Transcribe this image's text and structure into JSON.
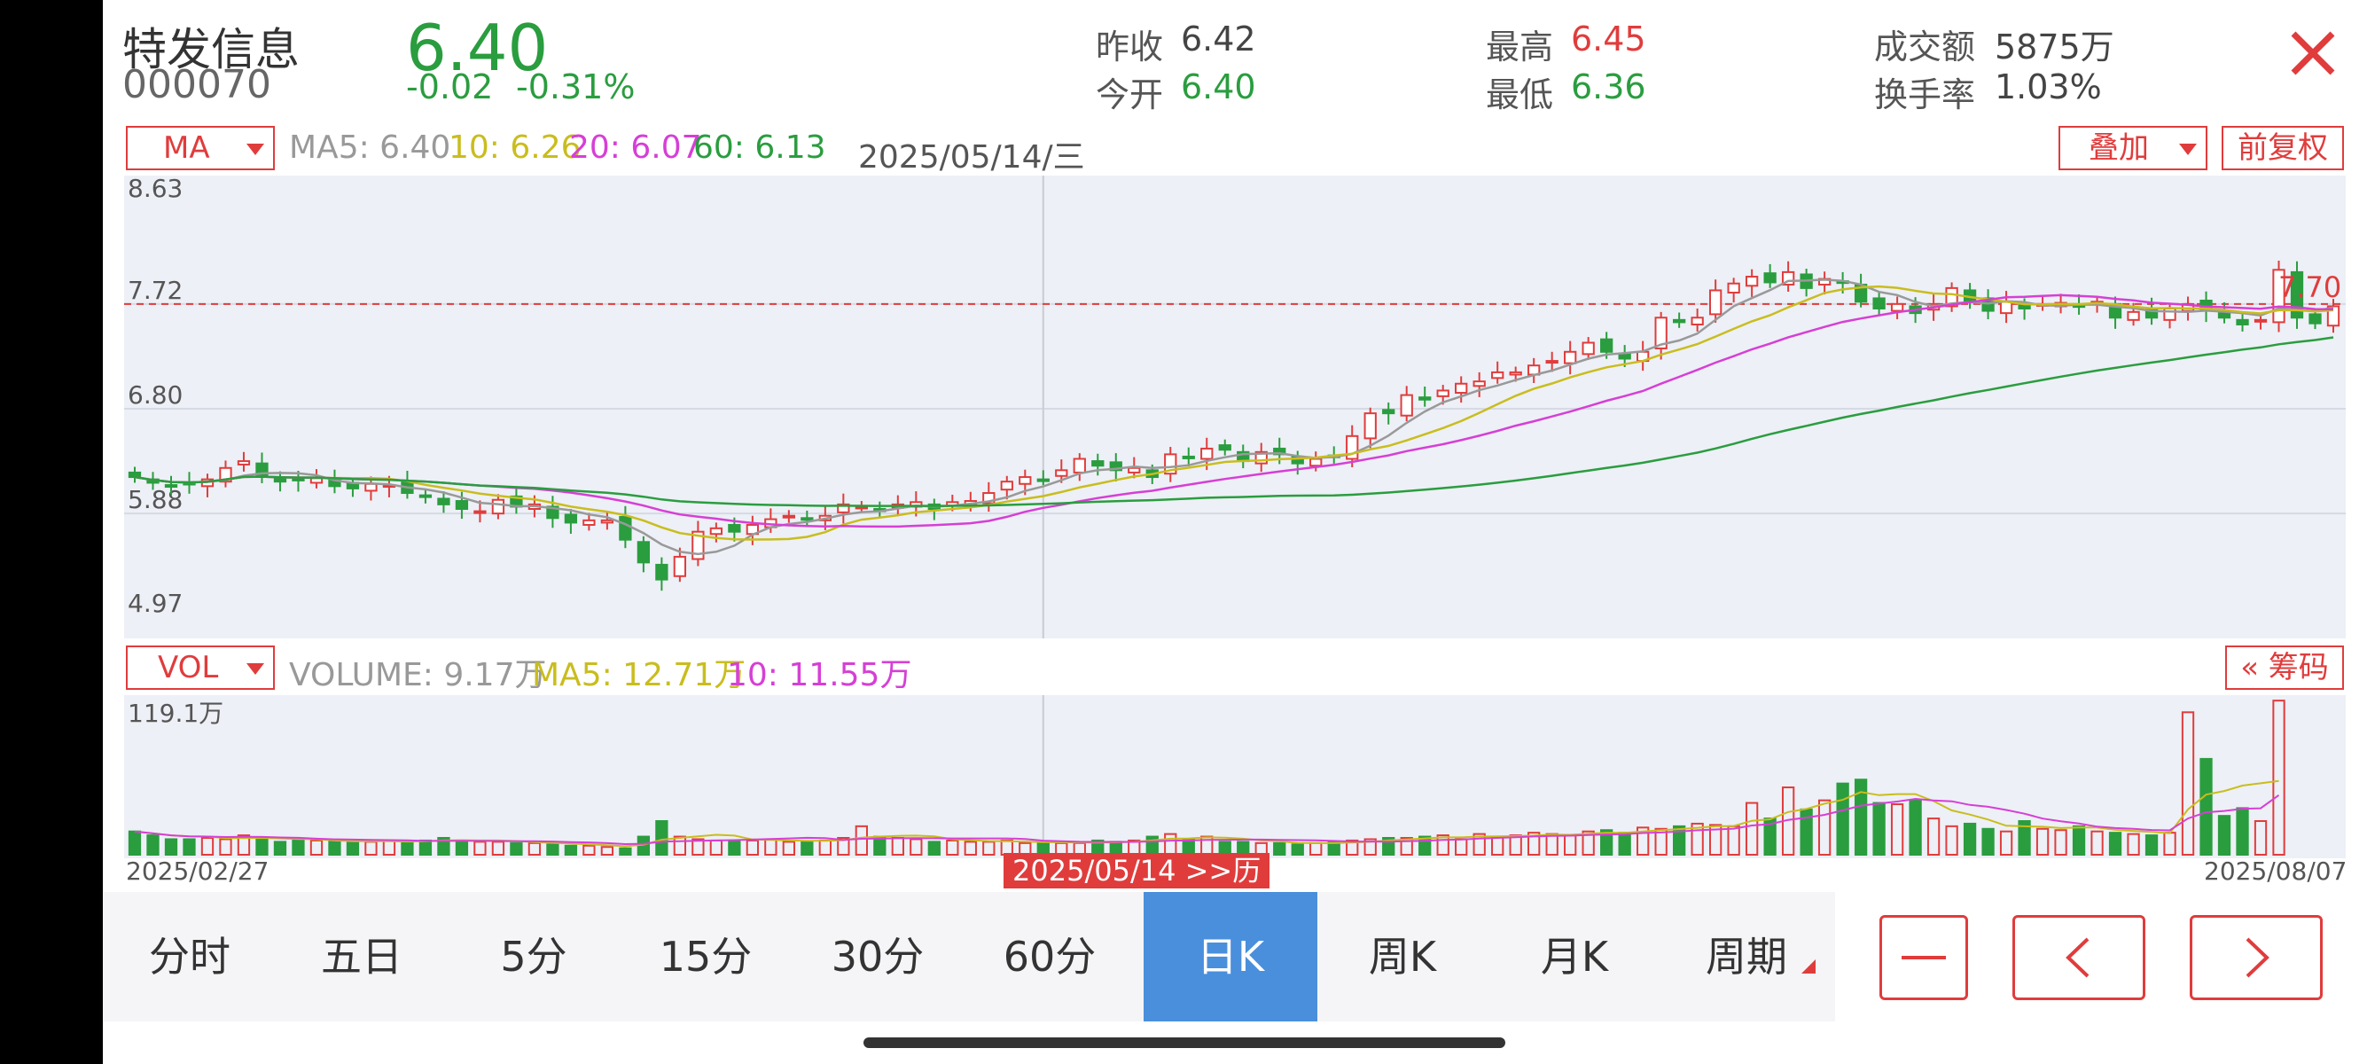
{
  "stock": {
    "name": "特发信息",
    "code": "000070",
    "price": "6.40",
    "change": "-0.02",
    "change_pct": "-0.31%"
  },
  "quote": {
    "prev_close_label": "昨收",
    "prev_close": "6.42",
    "open_label": "今开",
    "open": "6.40",
    "high_label": "最高",
    "high": "6.45",
    "low_label": "最低",
    "low": "6.36",
    "turnover_label": "成交额",
    "turnover": "5875万",
    "turnover_rate_label": "换手率",
    "turnover_rate": "1.03%"
  },
  "colors": {
    "up": "#e03c3c",
    "down": "#2a9d3f",
    "accent": "#4a8fdc",
    "ma5": "#999999",
    "ma10": "#c9bd1e",
    "ma20": "#d63fd6",
    "ma60": "#2a9d3f"
  },
  "indicator_select": "MA",
  "ma_legend": {
    "ma5": "MA5: 6.40",
    "ma10": "10: 6.26",
    "ma20": "20: 6.07",
    "ma60": "60: 6.13"
  },
  "cursor_date": "2025/05/14/三",
  "overlay_select": "叠加",
  "adjust_button": "前复权",
  "vol_select": "VOL",
  "vol_legend": {
    "volume": "VOLUME: 9.17万",
    "ma5": "MA5: 12.71万",
    "ma10": "10: 11.55万"
  },
  "chips_button": "« 筹码",
  "chart_data": {
    "type": "candlestick",
    "y_axis_labels": [
      "8.63",
      "7.72",
      "6.80",
      "5.88",
      "4.97"
    ],
    "ylim": [
      4.97,
      8.63
    ],
    "reference_line": 7.72,
    "last_label": "7.70",
    "vol_max_label": "119.1万",
    "vol_max": 119.1,
    "start_date": "2025/02/27",
    "end_date": "2025/08/07",
    "cursor_tag": "2025/05/14 >>历",
    "closes": [
      6.2,
      6.15,
      6.12,
      6.14,
      6.18,
      6.28,
      6.34,
      6.22,
      6.16,
      6.17,
      6.19,
      6.12,
      6.1,
      6.14,
      6.13,
      6.06,
      6.03,
      5.96,
      5.92,
      5.9,
      6.0,
      5.94,
      5.96,
      5.84,
      5.8,
      5.82,
      5.82,
      5.65,
      5.45,
      5.3,
      5.5,
      5.72,
      5.75,
      5.72,
      5.78,
      5.83,
      5.86,
      5.84,
      5.86,
      5.96,
      5.94,
      5.9,
      5.96,
      5.98,
      5.92,
      5.98,
      5.99,
      6.06,
      6.16,
      6.2,
      6.18,
      6.26,
      6.36,
      6.3,
      6.26,
      6.28,
      6.2,
      6.4,
      6.38,
      6.45,
      6.44,
      6.34,
      6.42,
      6.4,
      6.32,
      6.36,
      6.38,
      6.56,
      6.76,
      6.76,
      6.92,
      6.88,
      6.96,
      7.02,
      7.04,
      7.12,
      7.12,
      7.18,
      7.22,
      7.3,
      7.38,
      7.3,
      7.24,
      7.3,
      7.6,
      7.56,
      7.6,
      7.84,
      7.9,
      7.96,
      7.91,
      8.0,
      7.86,
      7.94,
      7.91,
      7.74,
      7.68,
      7.72,
      7.64,
      7.72,
      7.86,
      7.74,
      7.66,
      7.74,
      7.68,
      7.72,
      7.73,
      7.7,
      7.74,
      7.6,
      7.65,
      7.6,
      7.68,
      7.72,
      7.66,
      7.6,
      7.54,
      7.58,
      8.02,
      7.6,
      7.55,
      7.7
    ],
    "volumes": [
      18,
      15,
      12,
      12,
      13,
      12,
      15,
      13,
      10,
      11,
      11,
      10,
      10,
      10,
      11,
      10,
      11,
      13,
      11,
      10,
      10,
      9,
      9,
      8,
      7,
      7,
      6,
      5,
      14,
      26,
      14,
      12,
      11,
      11,
      11,
      12,
      10,
      10,
      11,
      13,
      22,
      14,
      13,
      12,
      10,
      11,
      10,
      10,
      11,
      9,
      9,
      9,
      9,
      11,
      10,
      11,
      14,
      16,
      12,
      14,
      10,
      10,
      9,
      9,
      8,
      9,
      10,
      11,
      12,
      13,
      13,
      14,
      15,
      12,
      16,
      14,
      15,
      17,
      16,
      15,
      18,
      19,
      17,
      21,
      20,
      22,
      24,
      23,
      22,
      40,
      28,
      52,
      35,
      42,
      55,
      58,
      40,
      39,
      42,
      28,
      22,
      24,
      20,
      18,
      26,
      20,
      19,
      22,
      18,
      17,
      16,
      15,
      17,
      110,
      74,
      30,
      36,
      26,
      119
    ]
  },
  "periods": [
    "分时",
    "五日",
    "5分",
    "15分",
    "30分",
    "60分",
    "日K",
    "周K",
    "月K",
    "周期"
  ],
  "active_period": "日K",
  "nav": {
    "zoom_out": "minus-icon",
    "prev": "chevron-left-icon",
    "next": "chevron-right-icon"
  }
}
